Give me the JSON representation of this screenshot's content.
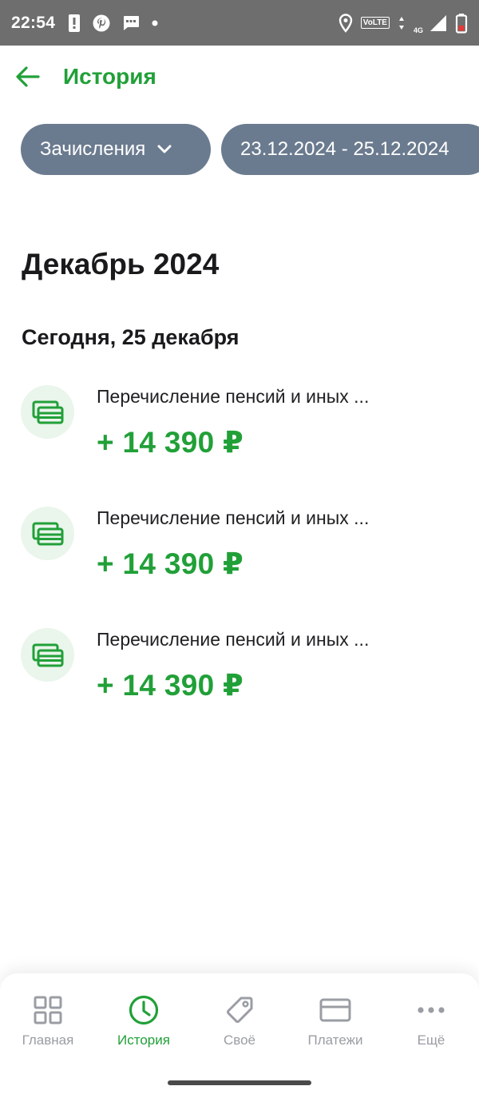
{
  "status_bar": {
    "time": "22:54",
    "left_icons": [
      "alert-icon",
      "pinterest-icon",
      "message-icon",
      "dot-icon"
    ],
    "right_icons": [
      "location-icon",
      "volte-icon",
      "network-icon",
      "signal-icon",
      "battery-icon"
    ],
    "volte_label": "VoLTE",
    "network_label": "4G"
  },
  "header": {
    "title": "История",
    "back_icon": "arrow-left-icon"
  },
  "filters": {
    "type_label": "Зачисления",
    "date_range": "23.12.2024 - 25.12.2024"
  },
  "content": {
    "month": "Декабрь 2024",
    "day": "Сегодня, 25 декабря",
    "operations": [
      {
        "title": "Перечисление пенсий и иных ...",
        "amount": "+ 14 390 ₽",
        "icon": "cards-icon"
      },
      {
        "title": "Перечисление пенсий и иных ...",
        "amount": "+ 14 390 ₽",
        "icon": "cards-icon"
      },
      {
        "title": "Перечисление пенсий и иных ...",
        "amount": "+ 14 390 ₽",
        "icon": "cards-icon"
      }
    ]
  },
  "bottom_nav": {
    "items": [
      {
        "label": "Главная",
        "icon": "grid-icon",
        "active": false
      },
      {
        "label": "История",
        "icon": "clock-icon",
        "active": true
      },
      {
        "label": "Своё",
        "icon": "tag-icon",
        "active": false
      },
      {
        "label": "Платежи",
        "icon": "card-icon",
        "active": false
      },
      {
        "label": "Ещё",
        "icon": "more-icon",
        "active": false
      }
    ]
  },
  "colors": {
    "accent": "#21a038",
    "chip_bg": "#6b7b8f",
    "status_bar_bg": "#6e6e6e",
    "icon_bg": "#eaf5ec",
    "nav_inactive": "#9a9da3"
  }
}
